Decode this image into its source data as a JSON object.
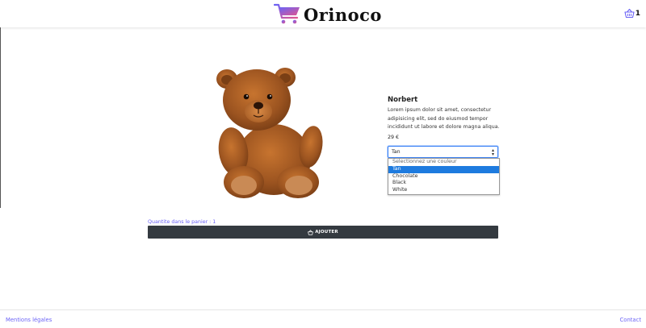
{
  "header": {
    "brand": "Orinoco",
    "cart_count": "1",
    "colors": {
      "brand_gradient_start": "#6b63f6",
      "brand_gradient_end": "#e0558f"
    }
  },
  "product": {
    "name": "Norbert",
    "description": "Lorem ipsum dolor sit amet, consectetur adipisicing elit, sed do eiusmod tempor incididunt ut labore et dolore magna aliqua.",
    "price": "29 €",
    "image_icon": "teddy-bear-image"
  },
  "color_select": {
    "selected": "Tan",
    "options": [
      {
        "label": "Selectionnez une couleur"
      },
      {
        "label": "Tan"
      },
      {
        "label": "Chocolate"
      },
      {
        "label": "Black"
      },
      {
        "label": "White"
      }
    ]
  },
  "cart_panel": {
    "quantity_label": "Quantite dans le panier : 1",
    "add_button_label": "AJOUTER",
    "button_color": "#343a40"
  },
  "footer": {
    "legal_link": "Mentions légales",
    "contact_link": "Contact",
    "link_color": "#6b63f6"
  }
}
